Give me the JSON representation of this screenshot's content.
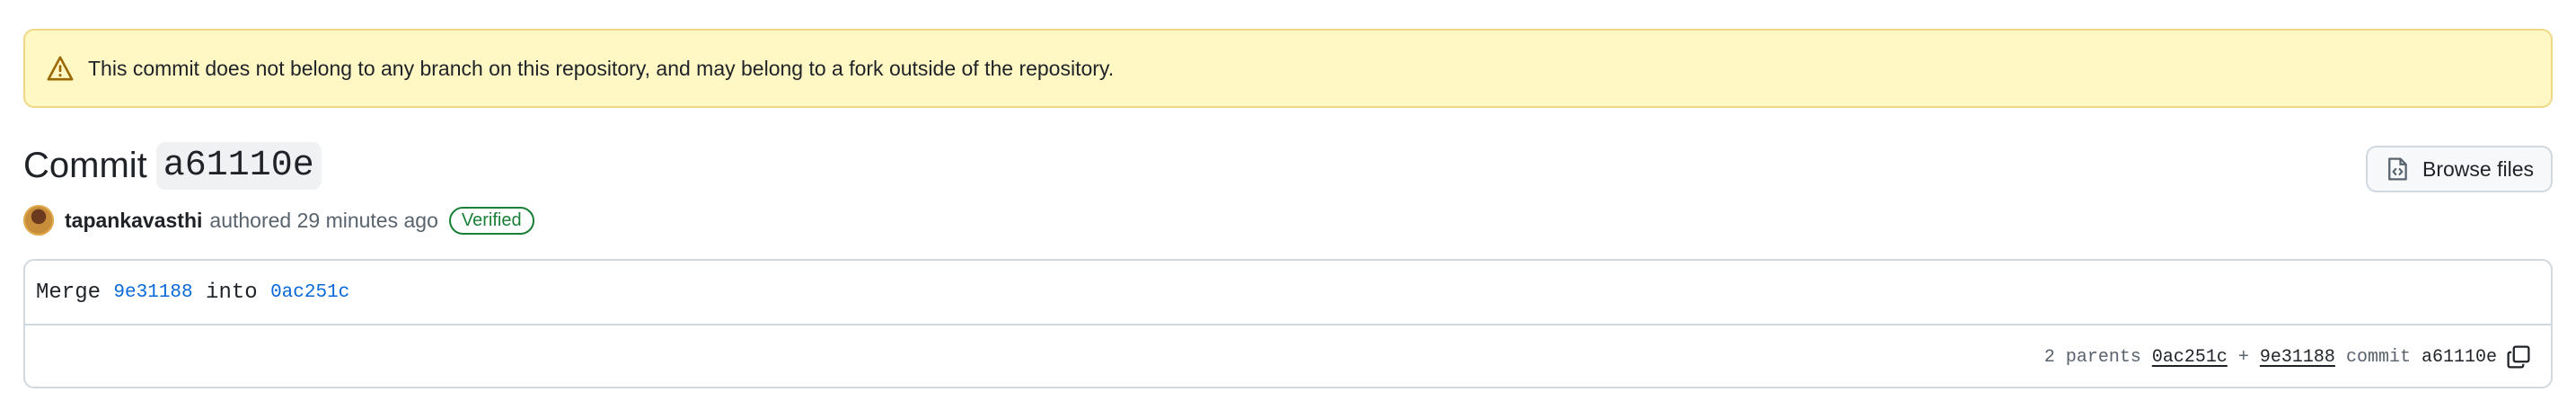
{
  "banner": {
    "icon": "alert-icon",
    "text": "This commit does not belong to any branch on this repository, and may belong to a fork outside of the repository."
  },
  "header": {
    "title_word": "Commit",
    "short_sha": "a61110e",
    "browse_label": "Browse files"
  },
  "author": {
    "name": "tapankavasthi",
    "authored_text": "authored 29 minutes ago",
    "badge": "Verified"
  },
  "message": {
    "prefix": "Merge",
    "head_sha": "9e31188",
    "middle": "into",
    "base_sha": "0ac251c"
  },
  "meta": {
    "parents_label": "2 parents",
    "parent1": "0ac251c",
    "plus": "+",
    "parent2": "9e31188",
    "commit_label": "commit",
    "commit_sha": "a61110e"
  },
  "colors": {
    "banner_bg": "#fff8c5",
    "banner_border": "#eed888",
    "link": "#0969da",
    "verified": "#1a7f37"
  }
}
